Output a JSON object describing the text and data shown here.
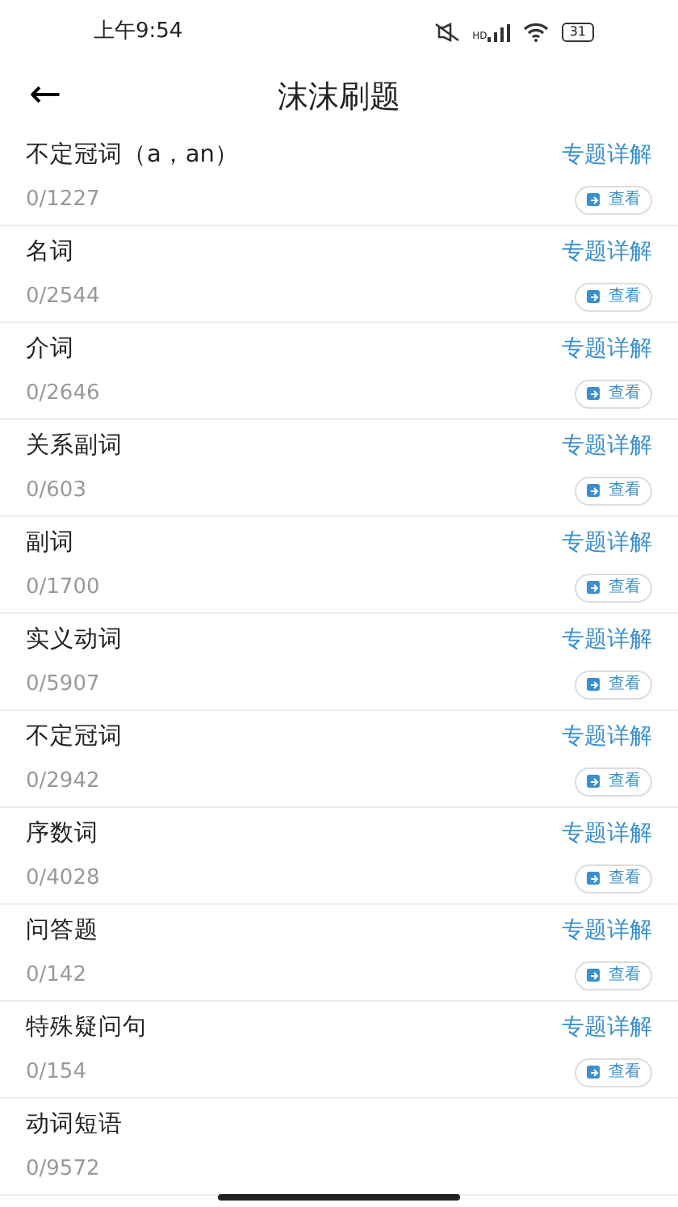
{
  "status_bar": {
    "time": "上午9:54",
    "network_label": "HD",
    "battery": "31"
  },
  "header": {
    "back": "←",
    "title": "沫沫刷题"
  },
  "topics": [
    {
      "name": "不定冠词（a，an）",
      "progress": "0/1227",
      "detail_link": "专题详解",
      "view_button": "查看"
    },
    {
      "name": "名词",
      "progress": "0/2544",
      "detail_link": "专题详解",
      "view_button": "查看"
    },
    {
      "name": "介词",
      "progress": "0/2646",
      "detail_link": "专题详解",
      "view_button": "查看"
    },
    {
      "name": "关系副词",
      "progress": "0/603",
      "detail_link": "专题详解",
      "view_button": "查看"
    },
    {
      "name": "副词",
      "progress": "0/1700",
      "detail_link": "专题详解",
      "view_button": "查看"
    },
    {
      "name": "实义动词",
      "progress": "0/5907",
      "detail_link": "专题详解",
      "view_button": "查看"
    },
    {
      "name": "不定冠词",
      "progress": "0/2942",
      "detail_link": "专题详解",
      "view_button": "查看"
    },
    {
      "name": "序数词",
      "progress": "0/4028",
      "detail_link": "专题详解",
      "view_button": "查看"
    },
    {
      "name": "问答题",
      "progress": "0/142",
      "detail_link": "专题详解",
      "view_button": "查看"
    },
    {
      "name": "特殊疑问句",
      "progress": "0/154",
      "detail_link": "专题详解",
      "view_button": "查看"
    },
    {
      "name": "动词短语",
      "progress": "0/9572"
    }
  ]
}
